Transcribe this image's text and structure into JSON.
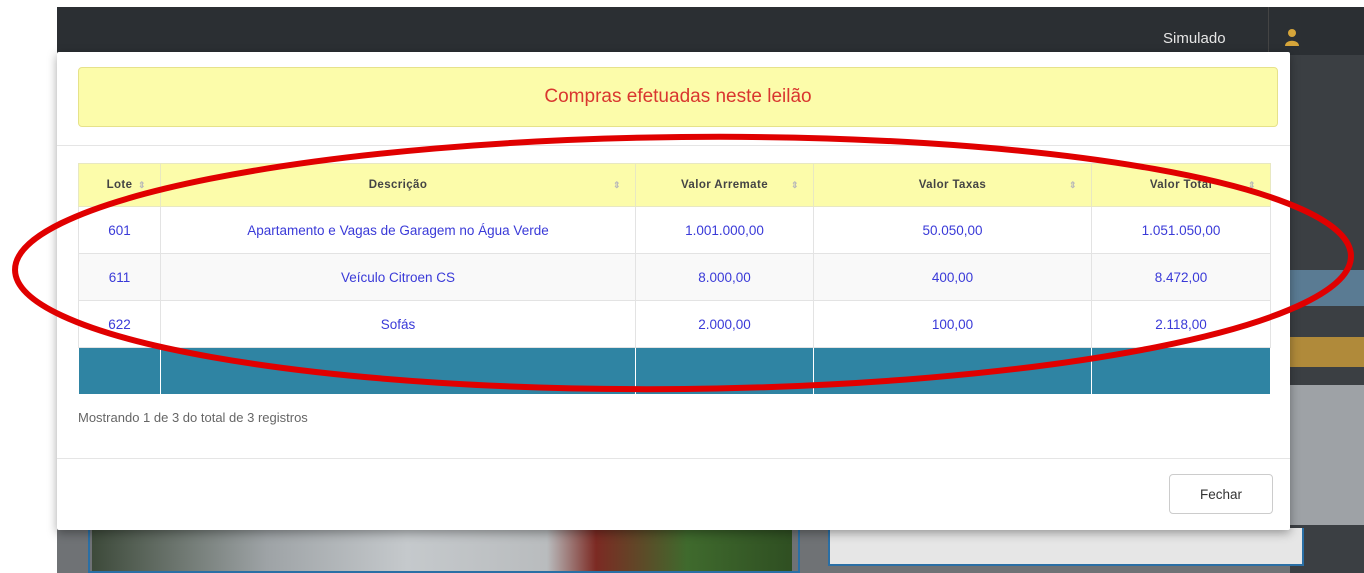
{
  "navbar": {
    "user_label": "Simulado"
  },
  "modal": {
    "title": "Compras efetuadas neste leilão",
    "table": {
      "columns": [
        "Lote",
        "Descrição",
        "Valor Arremate",
        "Valor Taxas",
        "Valor Total"
      ],
      "rows": [
        {
          "lote": "601",
          "descricao": "Apartamento e Vagas de Garagem no Água Verde",
          "valor_arremate": "1.001.000,00",
          "valor_taxas": "50.050,00",
          "valor_total": "1.051.050,00"
        },
        {
          "lote": "611",
          "descricao": "Veículo Citroen CS",
          "valor_arremate": "8.000,00",
          "valor_taxas": "400,00",
          "valor_total": "8.472,00"
        },
        {
          "lote": "622",
          "descricao": "Sofás",
          "valor_arremate": "2.000,00",
          "valor_taxas": "100,00",
          "valor_total": "2.118,00"
        }
      ]
    },
    "info": "Mostrando 1 de 3 do total de 3 registros",
    "close_label": "Fechar"
  },
  "colors": {
    "alert_bg": "#fcfcaa",
    "title_red": "#d9362f",
    "link_blue": "#3a3ad8",
    "footer_teal": "#2f84a3",
    "annotation_red": "#e00000"
  }
}
